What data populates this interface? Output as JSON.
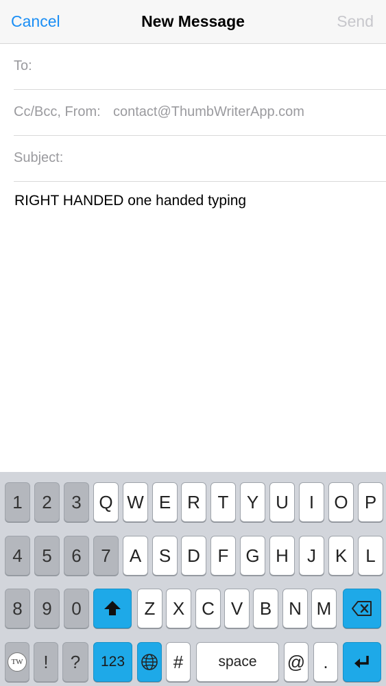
{
  "nav": {
    "cancel": "Cancel",
    "title": "New Message",
    "send": "Send"
  },
  "fields": {
    "to_label": "To:",
    "to_value": "",
    "ccbcc_label": "Cc/Bcc, From:",
    "from_value": "contact@ThumbWriterApp.com",
    "subject_label": "Subject:",
    "subject_value": ""
  },
  "body_text": "RIGHT HANDED one handed typing",
  "keyboard": {
    "row1": [
      "1",
      "2",
      "3",
      "Q",
      "W",
      "E",
      "R",
      "T",
      "Y",
      "U",
      "I",
      "O",
      "P"
    ],
    "row2": [
      "4",
      "5",
      "6",
      "7",
      "A",
      "S",
      "D",
      "F",
      "G",
      "H",
      "J",
      "K",
      "L"
    ],
    "row3_left": [
      "8",
      "9",
      "0"
    ],
    "row3_letters": [
      "Z",
      "X",
      "C",
      "V",
      "B",
      "N",
      "M"
    ],
    "row4_left": [
      "!",
      "?"
    ],
    "numbers_label": "123",
    "hash": "#",
    "space_label": "space",
    "at": "@",
    "dot": ".",
    "tw_logo": "TW",
    "colors": {
      "blue_key": "#1ea9e8",
      "gray_key": "#b4b7bd",
      "white_key": "#ffffff"
    }
  },
  "icons": {
    "shift": "shift-up-arrow-icon",
    "backspace": "backspace-icon",
    "globe": "globe-icon",
    "return": "return-arrow-icon"
  },
  "colors": {
    "accent": "#1a8ef5",
    "disabled": "#c7c7cc",
    "field_label": "#9a9a9e"
  }
}
